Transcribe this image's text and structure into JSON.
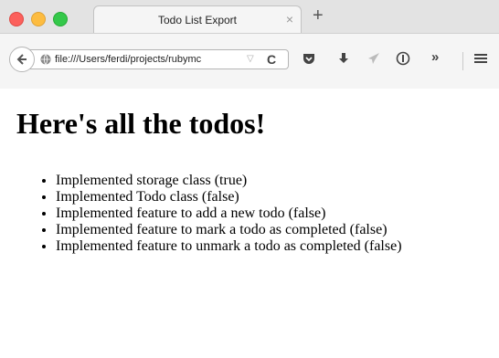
{
  "window": {
    "tab_title": "Todo List Export",
    "tab_close": "×",
    "new_tab": "+"
  },
  "toolbar": {
    "url": "file:///Users/ferdi/projects/rubymc",
    "url_dropdown": "▽",
    "reload": "C",
    "overflow": "»"
  },
  "page": {
    "heading": "Here's all the todos!",
    "todos": [
      "Implemented storage class (true)",
      "Implemented Todo class (false)",
      "Implemented feature to add a new todo (false)",
      "Implemented feature to mark a todo as completed (false)",
      "Implemented feature to unmark a todo as completed (false)"
    ]
  },
  "colors": {
    "chrome_bg": "#e3e3e3",
    "toolbar_bg": "#f5f5f5",
    "close_red": "#fc605c",
    "minimize_yellow": "#fdbc40",
    "zoom_green": "#34c84a"
  },
  "icons": [
    "back-arrow-icon",
    "globe-icon",
    "reload-icon",
    "pocket-icon",
    "download-icon",
    "send-icon",
    "reader-icon",
    "overflow-icon",
    "hamburger-menu-icon"
  ]
}
